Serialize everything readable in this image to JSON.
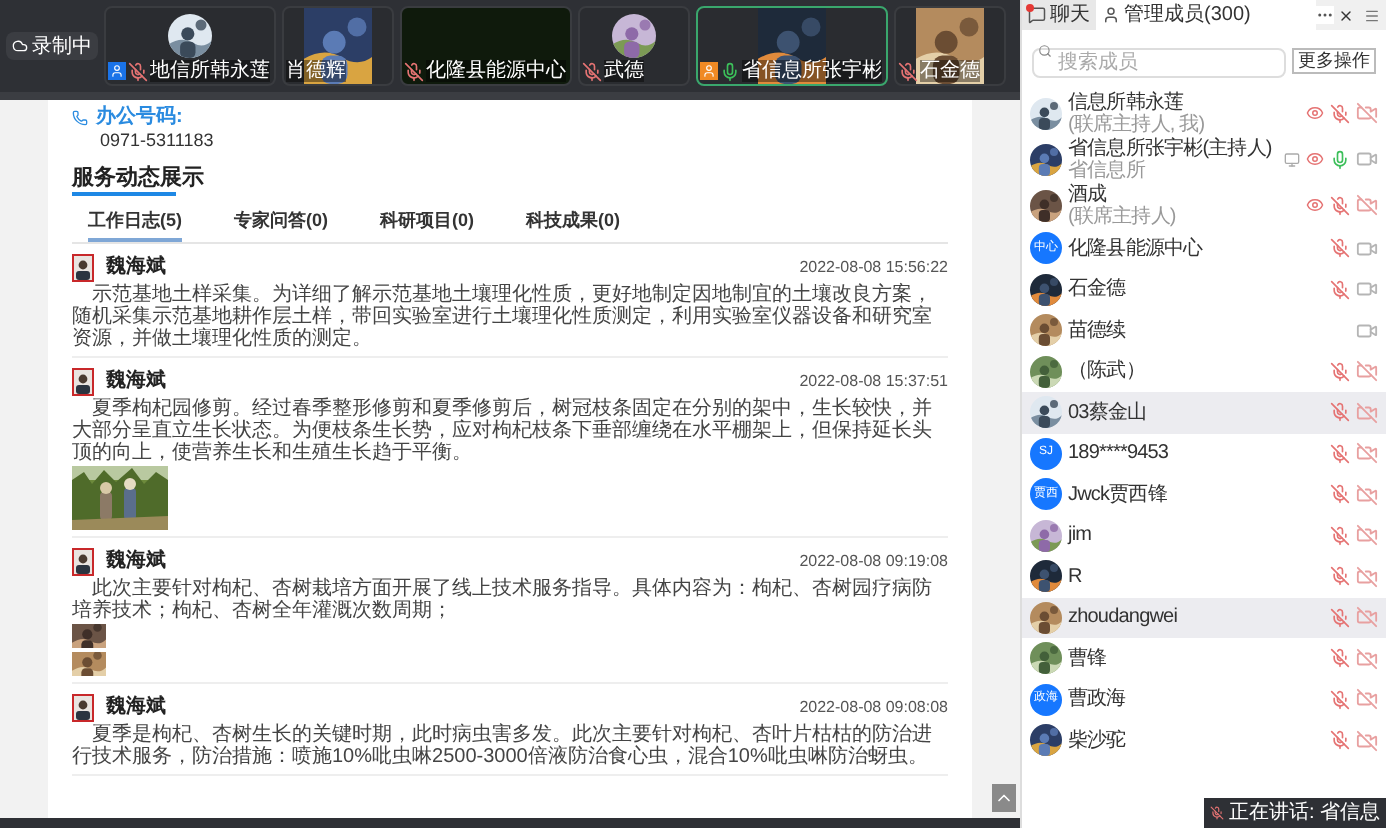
{
  "recording": {
    "label": "录制中"
  },
  "video_tiles": [
    {
      "name": "地信所韩永莲",
      "color": "#1a73e8",
      "mic_muted": true,
      "active": false,
      "kind": "avatar"
    },
    {
      "name": "肖德辉",
      "active": false,
      "kind": "video"
    },
    {
      "name": "化隆县能源中心",
      "mic_muted": true,
      "active": false,
      "kind": "blank"
    },
    {
      "name": "武德",
      "mic_muted": true,
      "active": false,
      "kind": "avatar"
    },
    {
      "name": "省信息所张宇彬",
      "color": "#f08a24",
      "mic_muted": false,
      "active": true,
      "kind": "video"
    },
    {
      "name": "石金德",
      "mic_muted": true,
      "active": false,
      "kind": "video"
    }
  ],
  "contact": {
    "label": "办公号码:",
    "value": "0971-5311183"
  },
  "section_title": "服务动态展示",
  "tabs": [
    {
      "label": "工作日志(5)",
      "selected": true
    },
    {
      "label": "专家问答(0)",
      "selected": false
    },
    {
      "label": "科研项目(0)",
      "selected": false
    },
    {
      "label": "科技成果(0)",
      "selected": false
    }
  ],
  "posts": [
    {
      "author": "魏海斌",
      "time": "2022-08-08 15:56:22",
      "text": "示范基地土样采集。为详细了解示范基地土壤理化性质，更好地制定因地制宜的土壤改良方案，随机采集示范基地耕作层土样，带回实验室进行土壤理化性质测定，利用实验室仪器设备和研究室资源，并做土壤理化性质的测定。",
      "kind": "text"
    },
    {
      "author": "魏海斌",
      "time": "2022-08-08 15:37:51",
      "text": "夏季枸杞园修剪。经过春季整形修剪和夏季修剪后，树冠枝条固定在分别的架中，生长较快，并大部分呈直立生长状态。为便枝条生长势，应对枸杞枝条下垂部缠绕在水平棚架上，但保持延长头顶的向上，使营养生长和生殖生长趋于平衡。"
    },
    {
      "author": "魏海斌",
      "time": "2022-08-08 09:19:08",
      "text": "此次主要针对枸杞、杏树栽培方面开展了线上技术服务指导。具体内容为：枸杞、杏树园疗病防培养技术；枸杞、杏树全年灌溉次数周期；",
      "kind": "photo_pair"
    },
    {
      "author": "魏海斌",
      "time": "2022-08-08 09:08:08",
      "text": "夏季是枸杞、杏树生长的关键时期，此时病虫害多发。此次主要针对枸杞、杏叶片枯枯的防治进行技术服务，防治措施：喷施10%吡虫啉2500-3000倍液防治食心虫，混合10%吡虫啉防治蚜虫。",
      "kind": "text"
    }
  ],
  "panel": {
    "tabs": [
      {
        "label": "聊天",
        "selected": false,
        "unread": true
      },
      {
        "label": "管理成员(300)",
        "selected": true
      }
    ],
    "search": {
      "placeholder": "搜索成员"
    },
    "more_button": "更多操作",
    "members": [
      {
        "name": "信息所韩永莲",
        "role": "(联席主持人, 我)",
        "view": true,
        "screen": false,
        "mic_muted": true,
        "camera_blocked": true,
        "selected": false
      },
      {
        "name": "省信息所张宇彬(主持人)",
        "role": "省信息所",
        "view": true,
        "screen": true,
        "mic_muted": false,
        "camera_blocked": false,
        "selected": false
      },
      {
        "name": "酒成",
        "role": "(联席主持人)",
        "view": true,
        "screen": false,
        "mic_muted": true,
        "camera_blocked": true,
        "selected": false
      },
      {
        "name": "化隆县能源中心",
        "avatar": {
          "kind": "initials",
          "text": "中心"
        },
        "view": false,
        "screen": false,
        "mic_muted": true,
        "camera_blocked": false,
        "selected": false
      },
      {
        "name": "石金德",
        "view": false,
        "screen": false,
        "mic_muted": true,
        "camera_blocked": false,
        "selected": false
      },
      {
        "name": "苗德续",
        "view": false,
        "screen": false,
        "camera_blocked": false,
        "selected": false
      },
      {
        "name": "（陈武）",
        "view": false,
        "screen": false,
        "mic_muted": true,
        "camera_blocked": true,
        "selected": false
      },
      {
        "name": "03蔡金山",
        "view": false,
        "screen": false,
        "mic_muted": true,
        "camera_blocked": true,
        "selected": true
      },
      {
        "name": "189****9453",
        "avatar": {
          "kind": "initials",
          "text": "SJ"
        },
        "view": false,
        "screen": false,
        "mic_muted": true,
        "camera_blocked": true,
        "selected": false
      },
      {
        "name": "Jwck贾西锋",
        "avatar": {
          "kind": "initials",
          "text": "贾西"
        },
        "view": false,
        "screen": false,
        "mic_muted": true,
        "camera_blocked": true,
        "selected": false
      },
      {
        "name": "jim",
        "view": false,
        "screen": false,
        "mic_muted": true,
        "camera_blocked": true,
        "selected": false
      },
      {
        "name": "R",
        "view": false,
        "screen": false,
        "mic_muted": true,
        "camera_blocked": true,
        "selected": false
      },
      {
        "name": "zhoudangwei",
        "view": false,
        "screen": false,
        "mic_muted": true,
        "camera_blocked": true,
        "selected": true
      },
      {
        "name": "曹锋",
        "view": false,
        "screen": false,
        "mic_muted": true,
        "camera_blocked": true,
        "selected": false
      },
      {
        "name": "曹政海",
        "avatar": {
          "kind": "initials",
          "text": "政海"
        },
        "view": false,
        "screen": false,
        "mic_muted": true,
        "camera_blocked": true,
        "selected": false
      },
      {
        "name": "柴沙驼",
        "view": false,
        "screen": false,
        "mic_muted": true,
        "camera_blocked": true,
        "selected": false
      }
    ],
    "speaking": {
      "text": "正在讲话: 省信息"
    }
  }
}
